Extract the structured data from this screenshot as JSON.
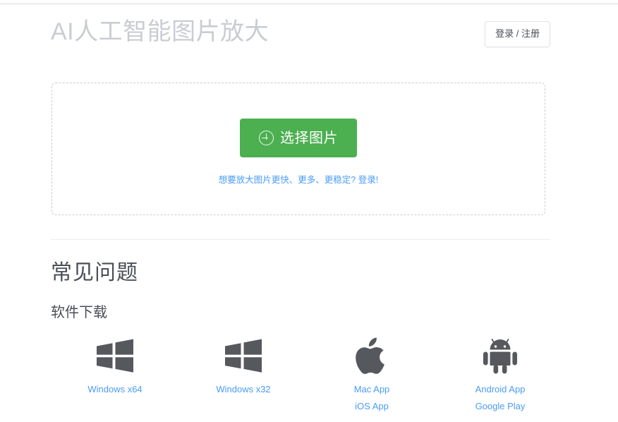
{
  "header": {
    "title": "AI人工智能图片放大",
    "login_label": "登录 / 注册"
  },
  "upload": {
    "select_button_label": "选择图片",
    "select_button_icon": "plus-circle-icon",
    "promo_text": "想要放大图片更快、更多、更稳定? 登录!"
  },
  "faq": {
    "title": "常见问题",
    "subtitle": "软件下载"
  },
  "downloads": [
    {
      "icon": "windows-logo-icon",
      "links": [
        "Windows x64"
      ]
    },
    {
      "icon": "windows-logo-icon",
      "links": [
        "Windows x32"
      ]
    },
    {
      "icon": "apple-logo-icon",
      "links": [
        "Mac App",
        "iOS App"
      ]
    },
    {
      "icon": "android-robot-icon",
      "links": [
        "Android App",
        "Google Play"
      ]
    }
  ],
  "colors": {
    "accent_green": "#4caf50",
    "link_blue": "#4a9cf6",
    "title_gray": "#c9cdd2",
    "text_dark": "#4a4f57",
    "icon_gray": "#55585c",
    "border_gray": "#cdcdcd"
  }
}
